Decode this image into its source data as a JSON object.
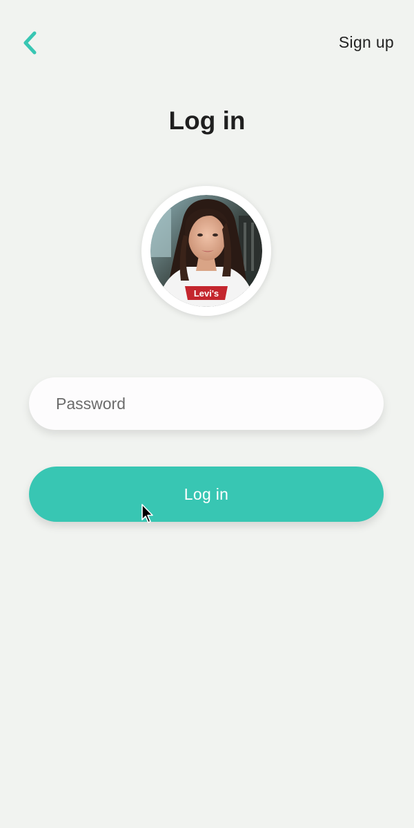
{
  "header": {
    "back_icon": "chevron-left-icon",
    "signup_label": "Sign up"
  },
  "title": "Log in",
  "avatar": {
    "shirt_text": "Levi's"
  },
  "password": {
    "placeholder": "Password",
    "value": ""
  },
  "login_button": {
    "label": "Log in"
  },
  "colors": {
    "accent": "#38c6b3",
    "background": "#f1f3f0",
    "text": "#222222"
  }
}
